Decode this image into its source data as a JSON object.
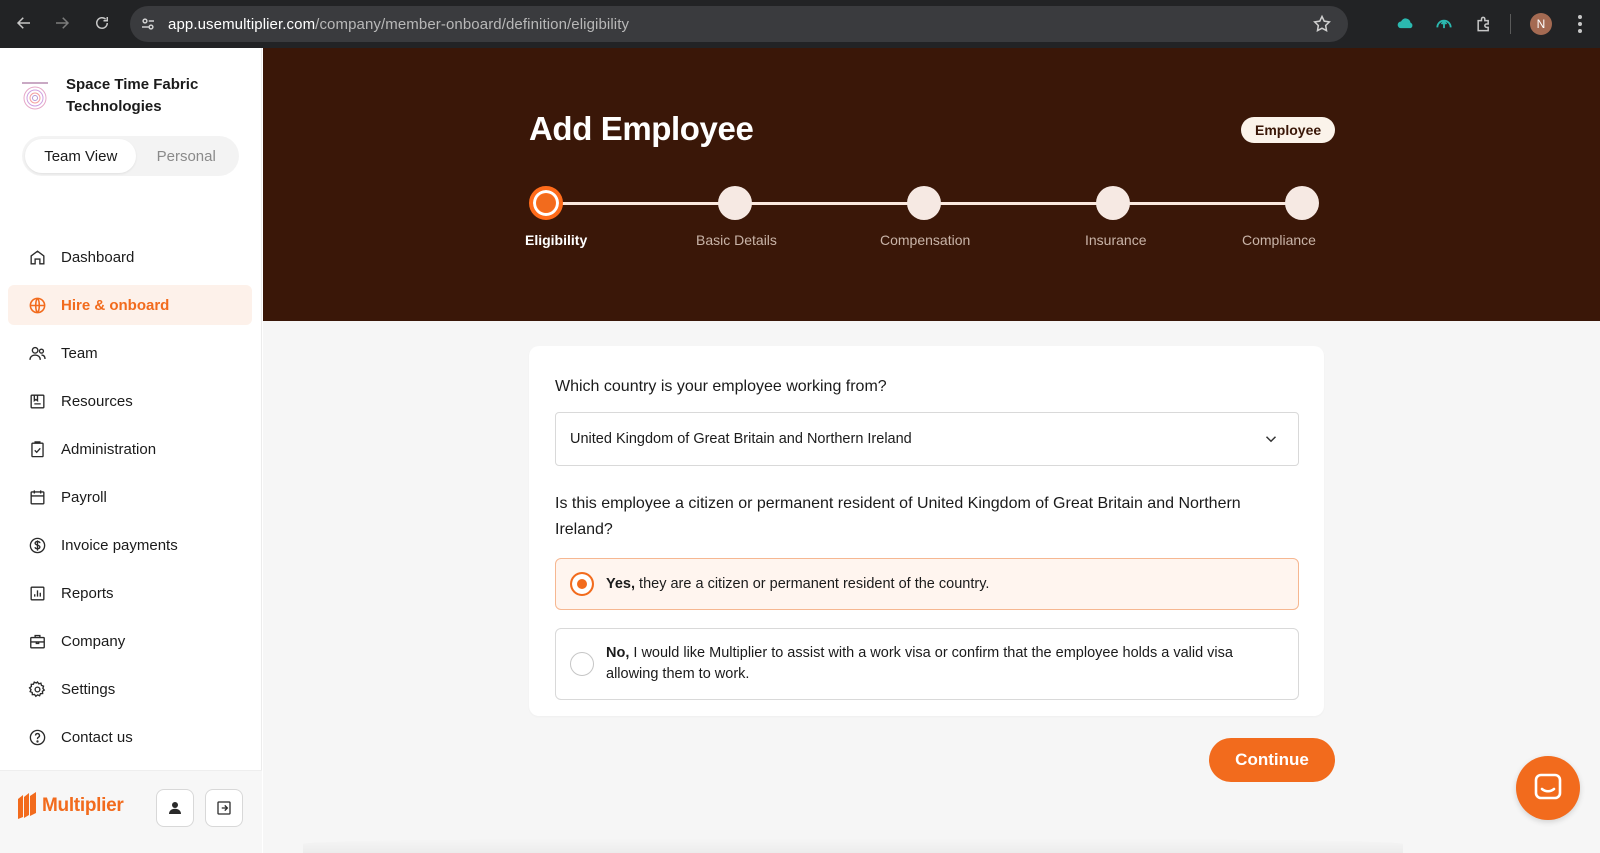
{
  "browser": {
    "url_domain": "app.usemultiplier.com",
    "url_path": "/company/member-onboard/definition/eligibility",
    "profile_initial": "N"
  },
  "sidebar": {
    "org_name": "Space Time Fabric Technologies",
    "view_toggle": {
      "active": "Team View",
      "inactive": "Personal"
    },
    "items": [
      {
        "label": "Dashboard",
        "icon": "home-icon"
      },
      {
        "label": "Hire & onboard",
        "icon": "globe-icon",
        "active": true
      },
      {
        "label": "Team",
        "icon": "team-icon"
      },
      {
        "label": "Resources",
        "icon": "resources-icon"
      },
      {
        "label": "Administration",
        "icon": "clipboard-check-icon"
      },
      {
        "label": "Payroll",
        "icon": "calendar-icon"
      },
      {
        "label": "Invoice payments",
        "icon": "dollar-icon"
      },
      {
        "label": "Reports",
        "icon": "bar-chart-icon"
      },
      {
        "label": "Company",
        "icon": "briefcase-icon"
      },
      {
        "label": "Settings",
        "icon": "gear-icon"
      },
      {
        "label": "Contact us",
        "icon": "help-icon"
      }
    ],
    "brand": "Multiplier"
  },
  "header": {
    "title": "Add Employee",
    "badge": "Employee",
    "steps": [
      "Eligibility",
      "Basic Details",
      "Compensation",
      "Insurance",
      "Compliance"
    ],
    "active_step": 0
  },
  "form": {
    "country_question": "Which country is your employee working from?",
    "country_value": "United Kingdom of Great Britain and Northern Ireland",
    "citizen_question": "Is this employee a citizen or permanent resident of United Kingdom of Great Britain and Northern Ireland?",
    "option_yes": {
      "bold": "Yes,",
      "text": " they are a citizen or permanent resident of the country.",
      "selected": true
    },
    "option_no": {
      "bold": "No,",
      "text": " I would like Multiplier to assist with a work visa or confirm that the employee holds a valid visa allowing them to work.",
      "selected": false
    },
    "continue_label": "Continue"
  },
  "colors": {
    "accent": "#f26b1d",
    "hero_bg": "#3a1708"
  }
}
